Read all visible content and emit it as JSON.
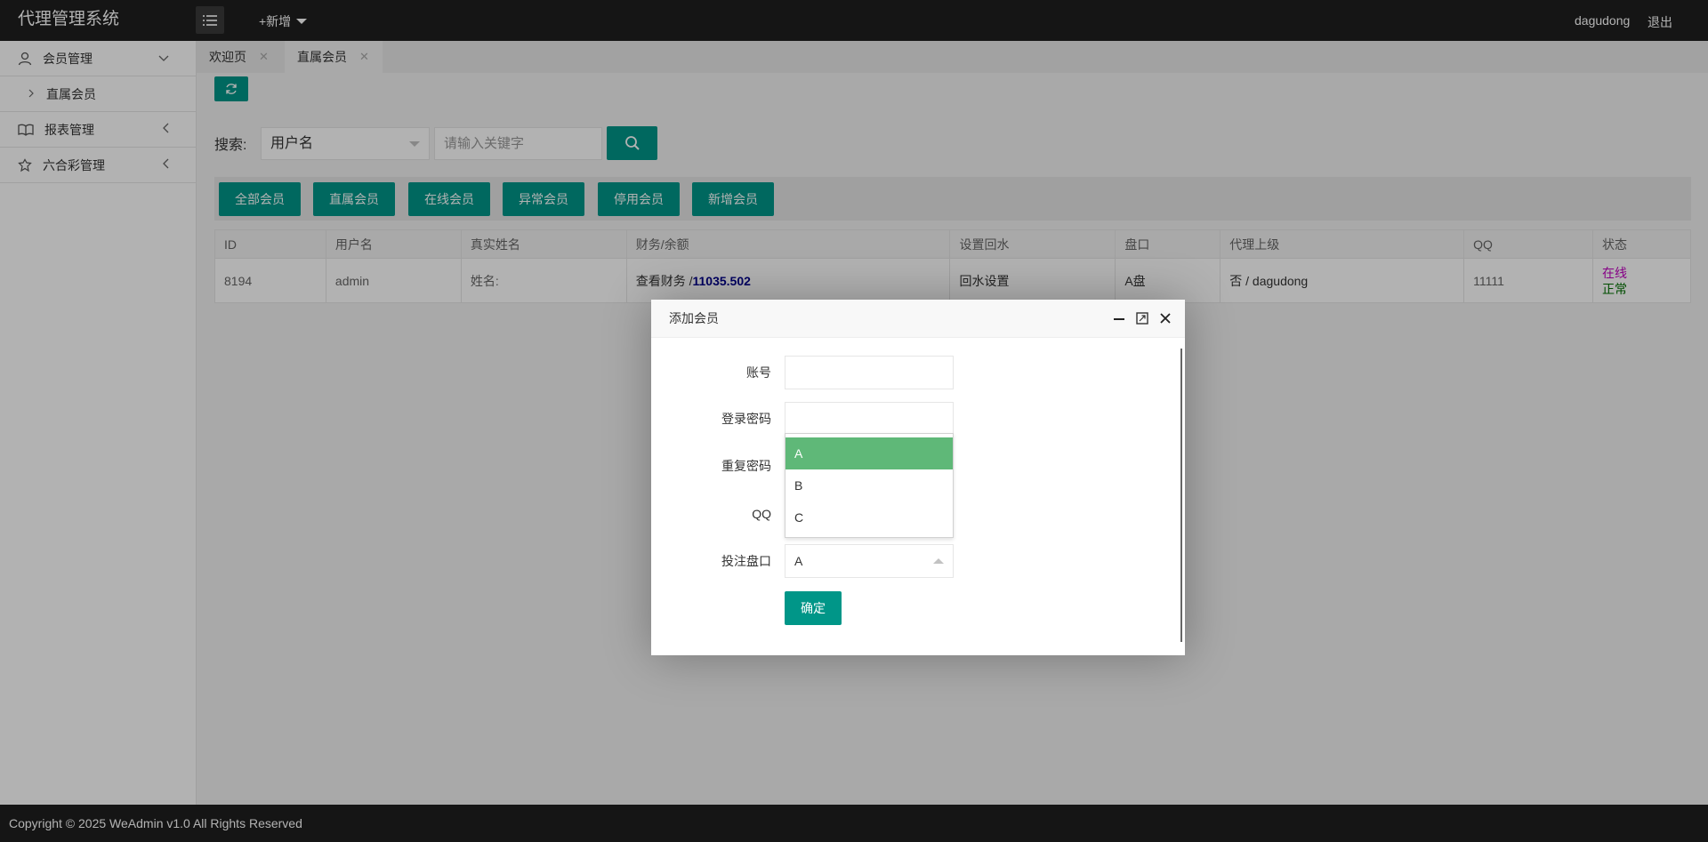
{
  "header": {
    "app_title": "代理管理系统",
    "add_new_label": "+新增",
    "user_name": "dagudong",
    "logout_label": "退出"
  },
  "sidebar": {
    "items": [
      {
        "label": "会员管理",
        "icon": "user-icon",
        "expanded": true,
        "children": [
          {
            "label": "直属会员"
          }
        ]
      },
      {
        "label": "报表管理",
        "icon": "book-icon",
        "expanded": false
      },
      {
        "label": "六合彩管理",
        "icon": "lottery-icon",
        "expanded": false
      }
    ]
  },
  "tabs": [
    {
      "label": "欢迎页",
      "active": false
    },
    {
      "label": "直属会员",
      "active": true
    }
  ],
  "search": {
    "label": "搜索:",
    "field_selected": "用户名",
    "placeholder": "请输入关键字"
  },
  "filters": [
    "全部会员",
    "直属会员",
    "在线会员",
    "异常会员",
    "停用会员",
    "新增会员"
  ],
  "table": {
    "headers": [
      "ID",
      "用户名",
      "真实姓名",
      "财务/余额",
      "设置回水",
      "盘口",
      "代理上级",
      "QQ",
      "状态"
    ],
    "rows": [
      {
        "id": "8194",
        "username": "admin",
        "realname": "姓名:",
        "finance_label": "查看财务 /",
        "balance": "11035.502",
        "rebate": "回水设置",
        "pankou": "A盘",
        "agent": "否 / dagudong",
        "qq": "11111",
        "status_online": "在线",
        "status_normal": "正常"
      }
    ]
  },
  "dialog": {
    "title": "添加会员",
    "fields": {
      "account_label": "账号",
      "password_label": "登录密码",
      "repeat_password_label": "重复密码",
      "qq_label": "QQ",
      "pankou_label": "投注盘口",
      "pankou_value": "A"
    },
    "dropdown_options": [
      "A",
      "B",
      "C"
    ],
    "dropdown_selected": "A",
    "confirm_label": "确定"
  },
  "footer": {
    "copyright": "Copyright © 2025 WeAdmin v1.0 All Rights Reserved"
  },
  "colors": {
    "accent": "#009688",
    "header_bg": "#1f1f1f",
    "dropdown_selected": "#5fb878",
    "status_online": "#c000c0",
    "status_normal": "#007000"
  }
}
